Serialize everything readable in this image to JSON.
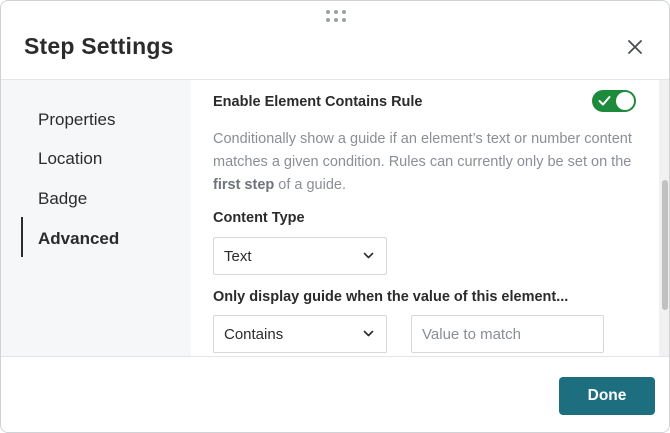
{
  "dialog": {
    "title": "Step Settings"
  },
  "sidebar": {
    "items": [
      {
        "label": "Properties",
        "active": false
      },
      {
        "label": "Location",
        "active": false
      },
      {
        "label": "Badge",
        "active": false
      },
      {
        "label": "Advanced",
        "active": true
      }
    ]
  },
  "rule": {
    "label": "Enable Element Contains Rule",
    "enabled": true,
    "description_pre": "Conditionally show a guide if an element’s text or number content matches a given condition. Rules can currently only be set on the ",
    "description_bold": "first step",
    "description_post": " of a guide."
  },
  "content_type": {
    "label": "Content Type",
    "selected": "Text"
  },
  "condition": {
    "label": "Only display guide when the value of this element...",
    "selected": "Contains",
    "placeholder": "Value to match",
    "value": ""
  },
  "footer": {
    "done_label": "Done"
  },
  "colors": {
    "accent": "#1d6f80",
    "toggle_on": "#1e8a3c"
  },
  "icons": {
    "close": "close-icon",
    "drag": "drag-handle-icon",
    "chevron": "chevron-down-icon",
    "check": "check-icon"
  }
}
